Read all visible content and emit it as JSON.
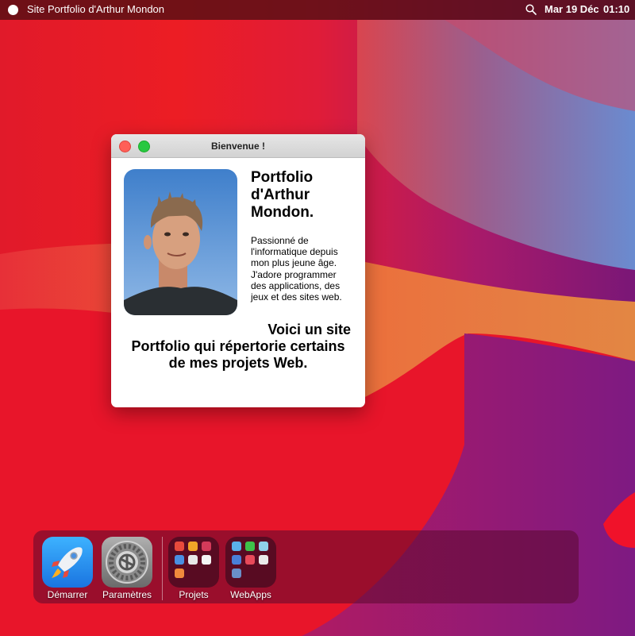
{
  "menubar": {
    "title": "Site Portfolio d'Arthur Mondon",
    "date": "Mar 19 Déc",
    "time": "01:10",
    "icons": [
      "apple-logo-icon",
      "search-icon"
    ]
  },
  "window": {
    "title": "Bienvenue !",
    "name": "Portfolio d'Arthur Mondon.",
    "bio": "Passionné de l'informatique depuis mon plus jeune âge. J'adore programmer des applications, des jeux et des sites web.",
    "intro": [
      "Voici un site",
      "Portfolio qui répertorie certains",
      "de mes projets Web."
    ]
  },
  "dock": {
    "items": [
      {
        "label": "Démarrer",
        "icon": "rocket-icon"
      },
      {
        "label": "Paramètres",
        "icon": "gear-icon"
      },
      {
        "label": "Projets",
        "icon": "folder-icon"
      },
      {
        "label": "WebApps",
        "icon": "folder-icon"
      }
    ]
  },
  "colors": {
    "wallpaper_primary": "#ec1d24",
    "wallpaper_secondary": "#8b1a78",
    "accent_blue": "#6b88c9",
    "close": "#ff5f57",
    "maximize": "#28c840"
  }
}
